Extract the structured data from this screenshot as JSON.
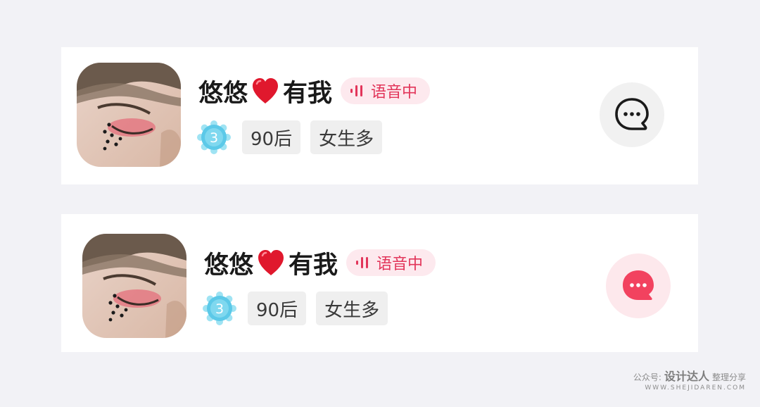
{
  "cards": [
    {
      "name_part1": "悠悠",
      "heart_icon": "red-heart-icon",
      "name_part2": "有我",
      "voice_badge": "语音中",
      "level": "3",
      "tags": [
        "90后",
        "女生多"
      ],
      "chat_icon": "chat-bubble-icon",
      "chat_style": "gray"
    },
    {
      "name_part1": "悠悠",
      "heart_icon": "red-heart-icon",
      "name_part2": "有我",
      "voice_badge": "语音中",
      "level": "3",
      "tags": [
        "90后",
        "女生多"
      ],
      "chat_icon": "chat-bubble-icon",
      "chat_style": "red"
    }
  ],
  "watermark": {
    "prefix": "公众号:",
    "brand": "设计达人",
    "suffix": "整理分享",
    "url": "WWW.SHEJIDAREN.COM"
  },
  "colors": {
    "background": "#f2f2f6",
    "accent": "#e2355a",
    "badge_bg": "#fde9ee",
    "tag_bg": "#efefef",
    "level_badge": "#5cc9e8"
  }
}
